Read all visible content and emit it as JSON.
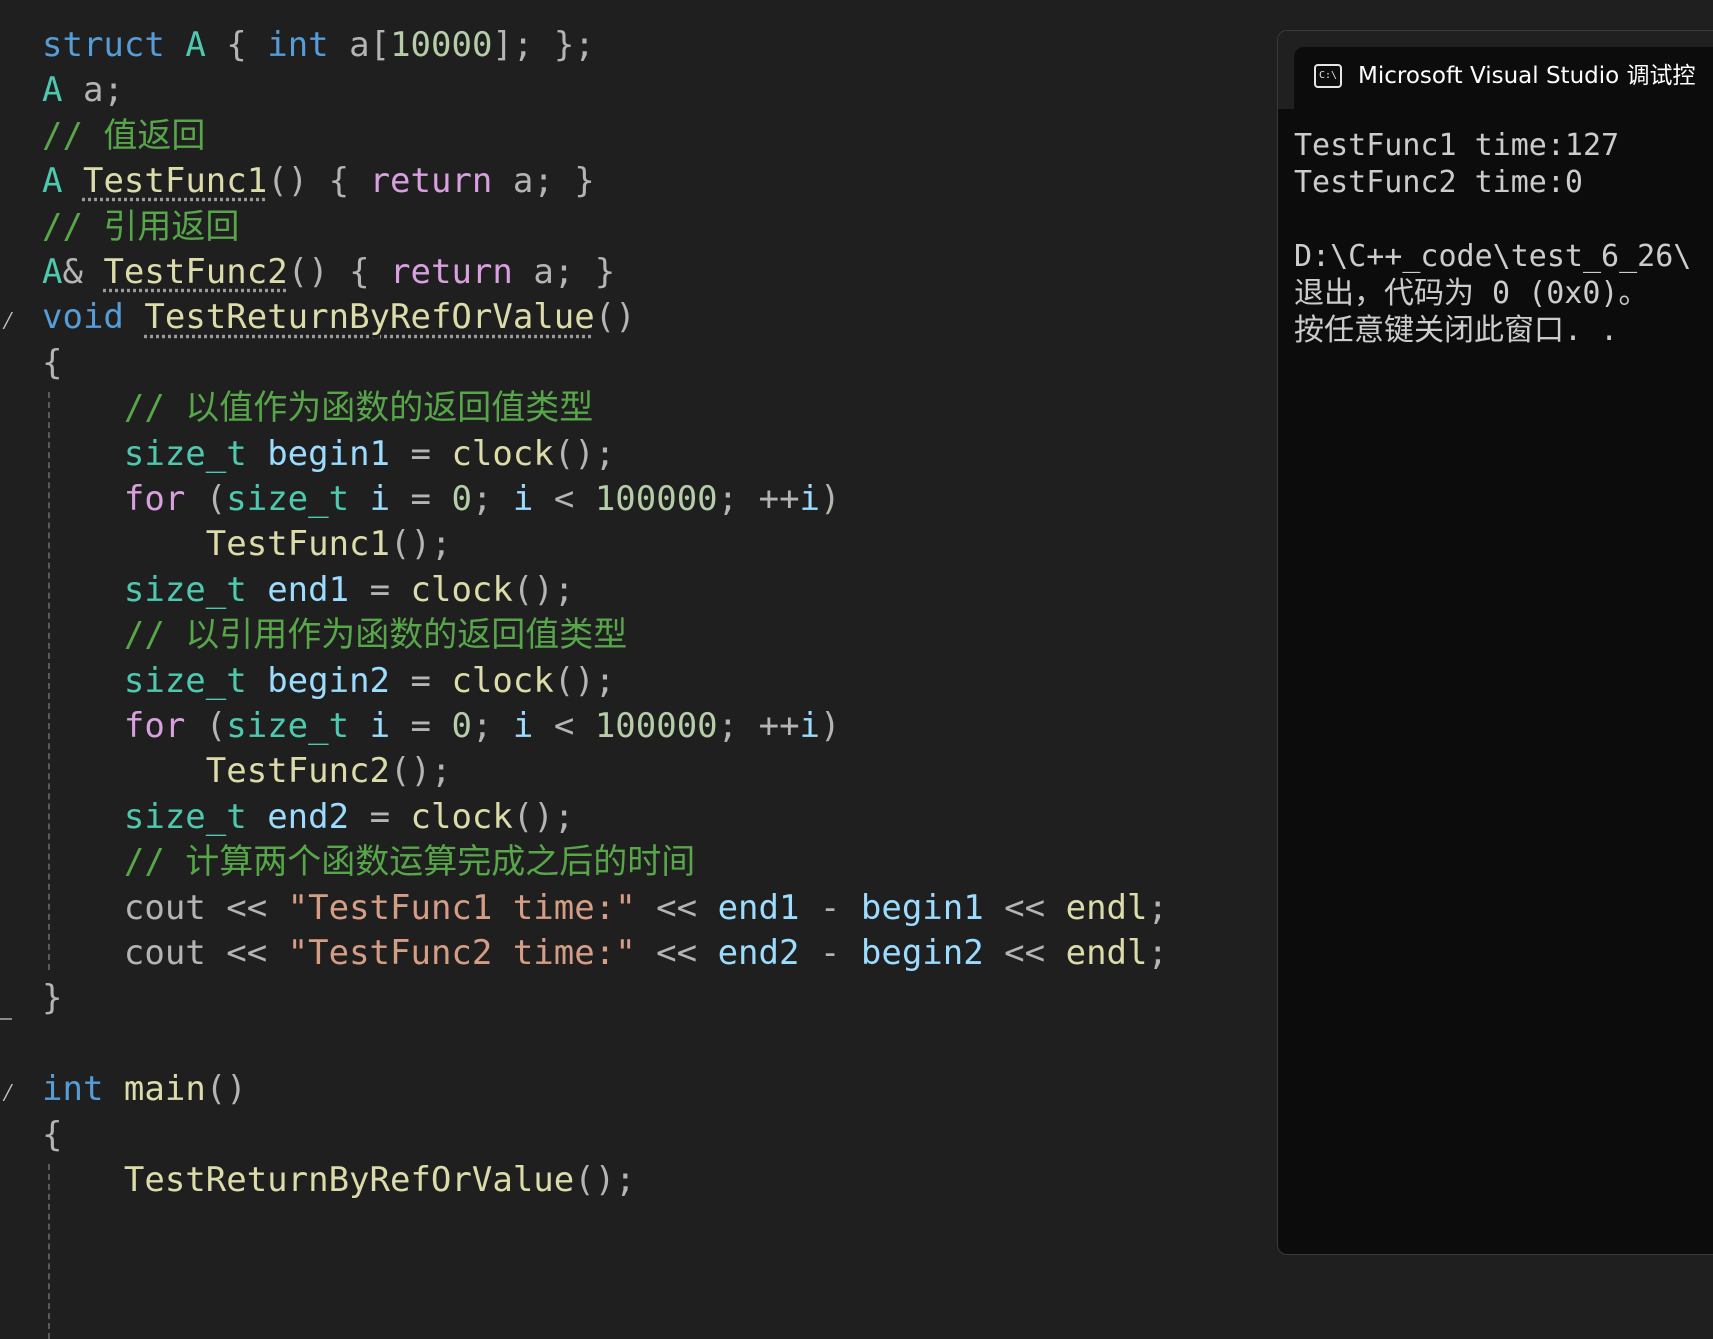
{
  "editor": {
    "lines": [
      [
        {
          "t": "struct",
          "c": "kw"
        },
        {
          "t": " "
        },
        {
          "t": "A",
          "c": "ty"
        },
        {
          "t": " { ",
          "c": "pn"
        },
        {
          "t": "int",
          "c": "kw"
        },
        {
          "t": " a[",
          "c": "pn"
        },
        {
          "t": "10000",
          "c": "nm"
        },
        {
          "t": "]; };",
          "c": "pn"
        }
      ],
      [
        {
          "t": "A",
          "c": "ty"
        },
        {
          "t": " a;",
          "c": "pn"
        }
      ],
      [
        {
          "t": "// 值返回",
          "c": "ct"
        }
      ],
      [
        {
          "t": "A",
          "c": "ty"
        },
        {
          "t": " "
        },
        {
          "t": "TestFunc1",
          "c": "fn squig"
        },
        {
          "t": "() { ",
          "c": "pn"
        },
        {
          "t": "return",
          "c": "cf"
        },
        {
          "t": " a; }",
          "c": "pn"
        }
      ],
      [
        {
          "t": "// 引用返回",
          "c": "ct"
        }
      ],
      [
        {
          "t": "A",
          "c": "ty"
        },
        {
          "t": "& ",
          "c": "pn"
        },
        {
          "t": "TestFunc2",
          "c": "fn squig"
        },
        {
          "t": "() { ",
          "c": "pn"
        },
        {
          "t": "return",
          "c": "cf"
        },
        {
          "t": " a; }",
          "c": "pn"
        }
      ],
      [
        {
          "t": "void",
          "c": "kw"
        },
        {
          "t": " "
        },
        {
          "t": "TestReturnByRefOrValue",
          "c": "fn squig"
        },
        {
          "t": "()",
          "c": "pn"
        }
      ],
      [
        {
          "t": "{",
          "c": "pn"
        }
      ],
      [
        {
          "t": "    "
        },
        {
          "t": "// 以值作为函数的返回值类型",
          "c": "ct"
        }
      ],
      [
        {
          "t": "    "
        },
        {
          "t": "size_t",
          "c": "ty"
        },
        {
          "t": " "
        },
        {
          "t": "begin1",
          "c": "vr"
        },
        {
          "t": " = ",
          "c": "pn"
        },
        {
          "t": "clock",
          "c": "fn"
        },
        {
          "t": "();",
          "c": "pn"
        }
      ],
      [
        {
          "t": "    "
        },
        {
          "t": "for",
          "c": "cf"
        },
        {
          "t": " (",
          "c": "pn"
        },
        {
          "t": "size_t",
          "c": "ty"
        },
        {
          "t": " "
        },
        {
          "t": "i",
          "c": "vr"
        },
        {
          "t": " = ",
          "c": "pn"
        },
        {
          "t": "0",
          "c": "nm"
        },
        {
          "t": "; ",
          "c": "pn"
        },
        {
          "t": "i",
          "c": "vr"
        },
        {
          "t": " < ",
          "c": "pn"
        },
        {
          "t": "100000",
          "c": "nm"
        },
        {
          "t": "; ++",
          "c": "pn"
        },
        {
          "t": "i",
          "c": "vr"
        },
        {
          "t": ")",
          "c": "pn"
        }
      ],
      [
        {
          "t": "        "
        },
        {
          "t": "TestFunc1",
          "c": "fn"
        },
        {
          "t": "();",
          "c": "pn"
        }
      ],
      [
        {
          "t": "    "
        },
        {
          "t": "size_t",
          "c": "ty"
        },
        {
          "t": " "
        },
        {
          "t": "end1",
          "c": "vr"
        },
        {
          "t": " = ",
          "c": "pn"
        },
        {
          "t": "clock",
          "c": "fn"
        },
        {
          "t": "();",
          "c": "pn"
        }
      ],
      [
        {
          "t": "    "
        },
        {
          "t": "// 以引用作为函数的返回值类型",
          "c": "ct"
        }
      ],
      [
        {
          "t": "    "
        },
        {
          "t": "size_t",
          "c": "ty"
        },
        {
          "t": " "
        },
        {
          "t": "begin2",
          "c": "vr"
        },
        {
          "t": " = ",
          "c": "pn"
        },
        {
          "t": "clock",
          "c": "fn"
        },
        {
          "t": "();",
          "c": "pn"
        }
      ],
      [
        {
          "t": "    "
        },
        {
          "t": "for",
          "c": "cf"
        },
        {
          "t": " (",
          "c": "pn"
        },
        {
          "t": "size_t",
          "c": "ty"
        },
        {
          "t": " "
        },
        {
          "t": "i",
          "c": "vr"
        },
        {
          "t": " = ",
          "c": "pn"
        },
        {
          "t": "0",
          "c": "nm"
        },
        {
          "t": "; ",
          "c": "pn"
        },
        {
          "t": "i",
          "c": "vr"
        },
        {
          "t": " < ",
          "c": "pn"
        },
        {
          "t": "100000",
          "c": "nm"
        },
        {
          "t": "; ++",
          "c": "pn"
        },
        {
          "t": "i",
          "c": "vr"
        },
        {
          "t": ")",
          "c": "pn"
        }
      ],
      [
        {
          "t": "        "
        },
        {
          "t": "TestFunc2",
          "c": "fn"
        },
        {
          "t": "();",
          "c": "pn"
        }
      ],
      [
        {
          "t": "    "
        },
        {
          "t": "size_t",
          "c": "ty"
        },
        {
          "t": " "
        },
        {
          "t": "end2",
          "c": "vr"
        },
        {
          "t": " = ",
          "c": "pn"
        },
        {
          "t": "clock",
          "c": "fn"
        },
        {
          "t": "();",
          "c": "pn"
        }
      ],
      [
        {
          "t": "    "
        },
        {
          "t": "// 计算两个函数运算完成之后的时间",
          "c": "ct"
        }
      ],
      [
        {
          "t": "    "
        },
        {
          "t": "cout",
          "c": "pn"
        },
        {
          "t": " << ",
          "c": "pn"
        },
        {
          "t": "\"TestFunc1 time:\"",
          "c": "st"
        },
        {
          "t": " << ",
          "c": "pn"
        },
        {
          "t": "end1",
          "c": "vr"
        },
        {
          "t": " - ",
          "c": "pn"
        },
        {
          "t": "begin1",
          "c": "vr"
        },
        {
          "t": " << ",
          "c": "pn"
        },
        {
          "t": "endl",
          "c": "fn"
        },
        {
          "t": ";",
          "c": "pn"
        }
      ],
      [
        {
          "t": "    "
        },
        {
          "t": "cout",
          "c": "pn"
        },
        {
          "t": " << ",
          "c": "pn"
        },
        {
          "t": "\"TestFunc2 time:\"",
          "c": "st"
        },
        {
          "t": " << ",
          "c": "pn"
        },
        {
          "t": "end2",
          "c": "vr"
        },
        {
          "t": " - ",
          "c": "pn"
        },
        {
          "t": "begin2",
          "c": "vr"
        },
        {
          "t": " << ",
          "c": "pn"
        },
        {
          "t": "endl",
          "c": "fn"
        },
        {
          "t": ";",
          "c": "pn"
        }
      ],
      [
        {
          "t": "}",
          "c": "pn"
        }
      ],
      [],
      [
        {
          "t": "int",
          "c": "kw"
        },
        {
          "t": " "
        },
        {
          "t": "main",
          "c": "fn"
        },
        {
          "t": "()",
          "c": "pn"
        }
      ],
      [
        {
          "t": "{",
          "c": "pn"
        }
      ],
      [
        {
          "t": "    "
        },
        {
          "t": "TestReturnByRefOrValue",
          "c": "fn"
        },
        {
          "t": "();",
          "c": "pn"
        }
      ]
    ]
  },
  "console": {
    "title": "Microsoft Visual Studio 调试控",
    "icon_glyph": "C:\\",
    "lines": [
      "TestFunc1 time:127",
      "TestFunc2 time:0",
      "",
      "D:\\C++_code\\test_6_26\\",
      "退出，代码为 0 (0x0)。",
      "按任意键关闭此窗口. ."
    ]
  }
}
